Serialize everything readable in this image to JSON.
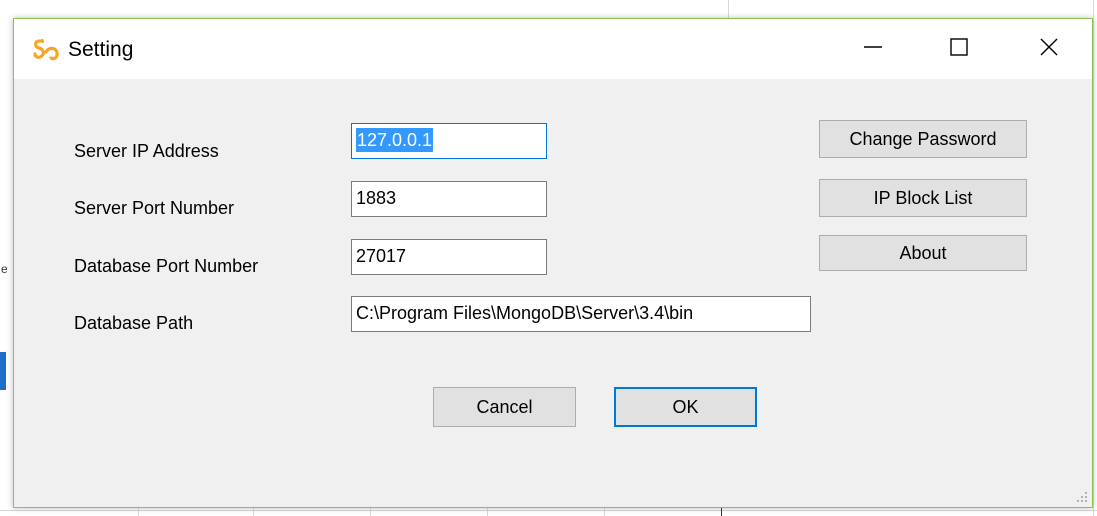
{
  "window": {
    "title": "Setting",
    "icon": "app-logo-icon",
    "controls": {
      "minimize": "minimize-icon",
      "maximize": "maximize-icon",
      "close": "close-icon"
    }
  },
  "form": {
    "server_ip": {
      "label": "Server IP Address",
      "value": "127.0.0.1"
    },
    "server_port": {
      "label": "Server Port Number",
      "value": "1883"
    },
    "db_port": {
      "label": "Database Port Number",
      "value": "27017"
    },
    "db_path": {
      "label": "Database Path",
      "value": "C:\\Program Files\\MongoDB\\Server\\3.4\\bin"
    }
  },
  "side_buttons": {
    "change_password": "Change Password",
    "ip_block_list": "IP Block List",
    "about": "About"
  },
  "footer_buttons": {
    "cancel": "Cancel",
    "ok": "OK"
  },
  "background": {
    "edge_glyph": "e"
  },
  "colors": {
    "accent": "#0078d7",
    "selection": "#3399ff",
    "window_border": "#8cc152",
    "icon_orange": "#f5a623"
  }
}
